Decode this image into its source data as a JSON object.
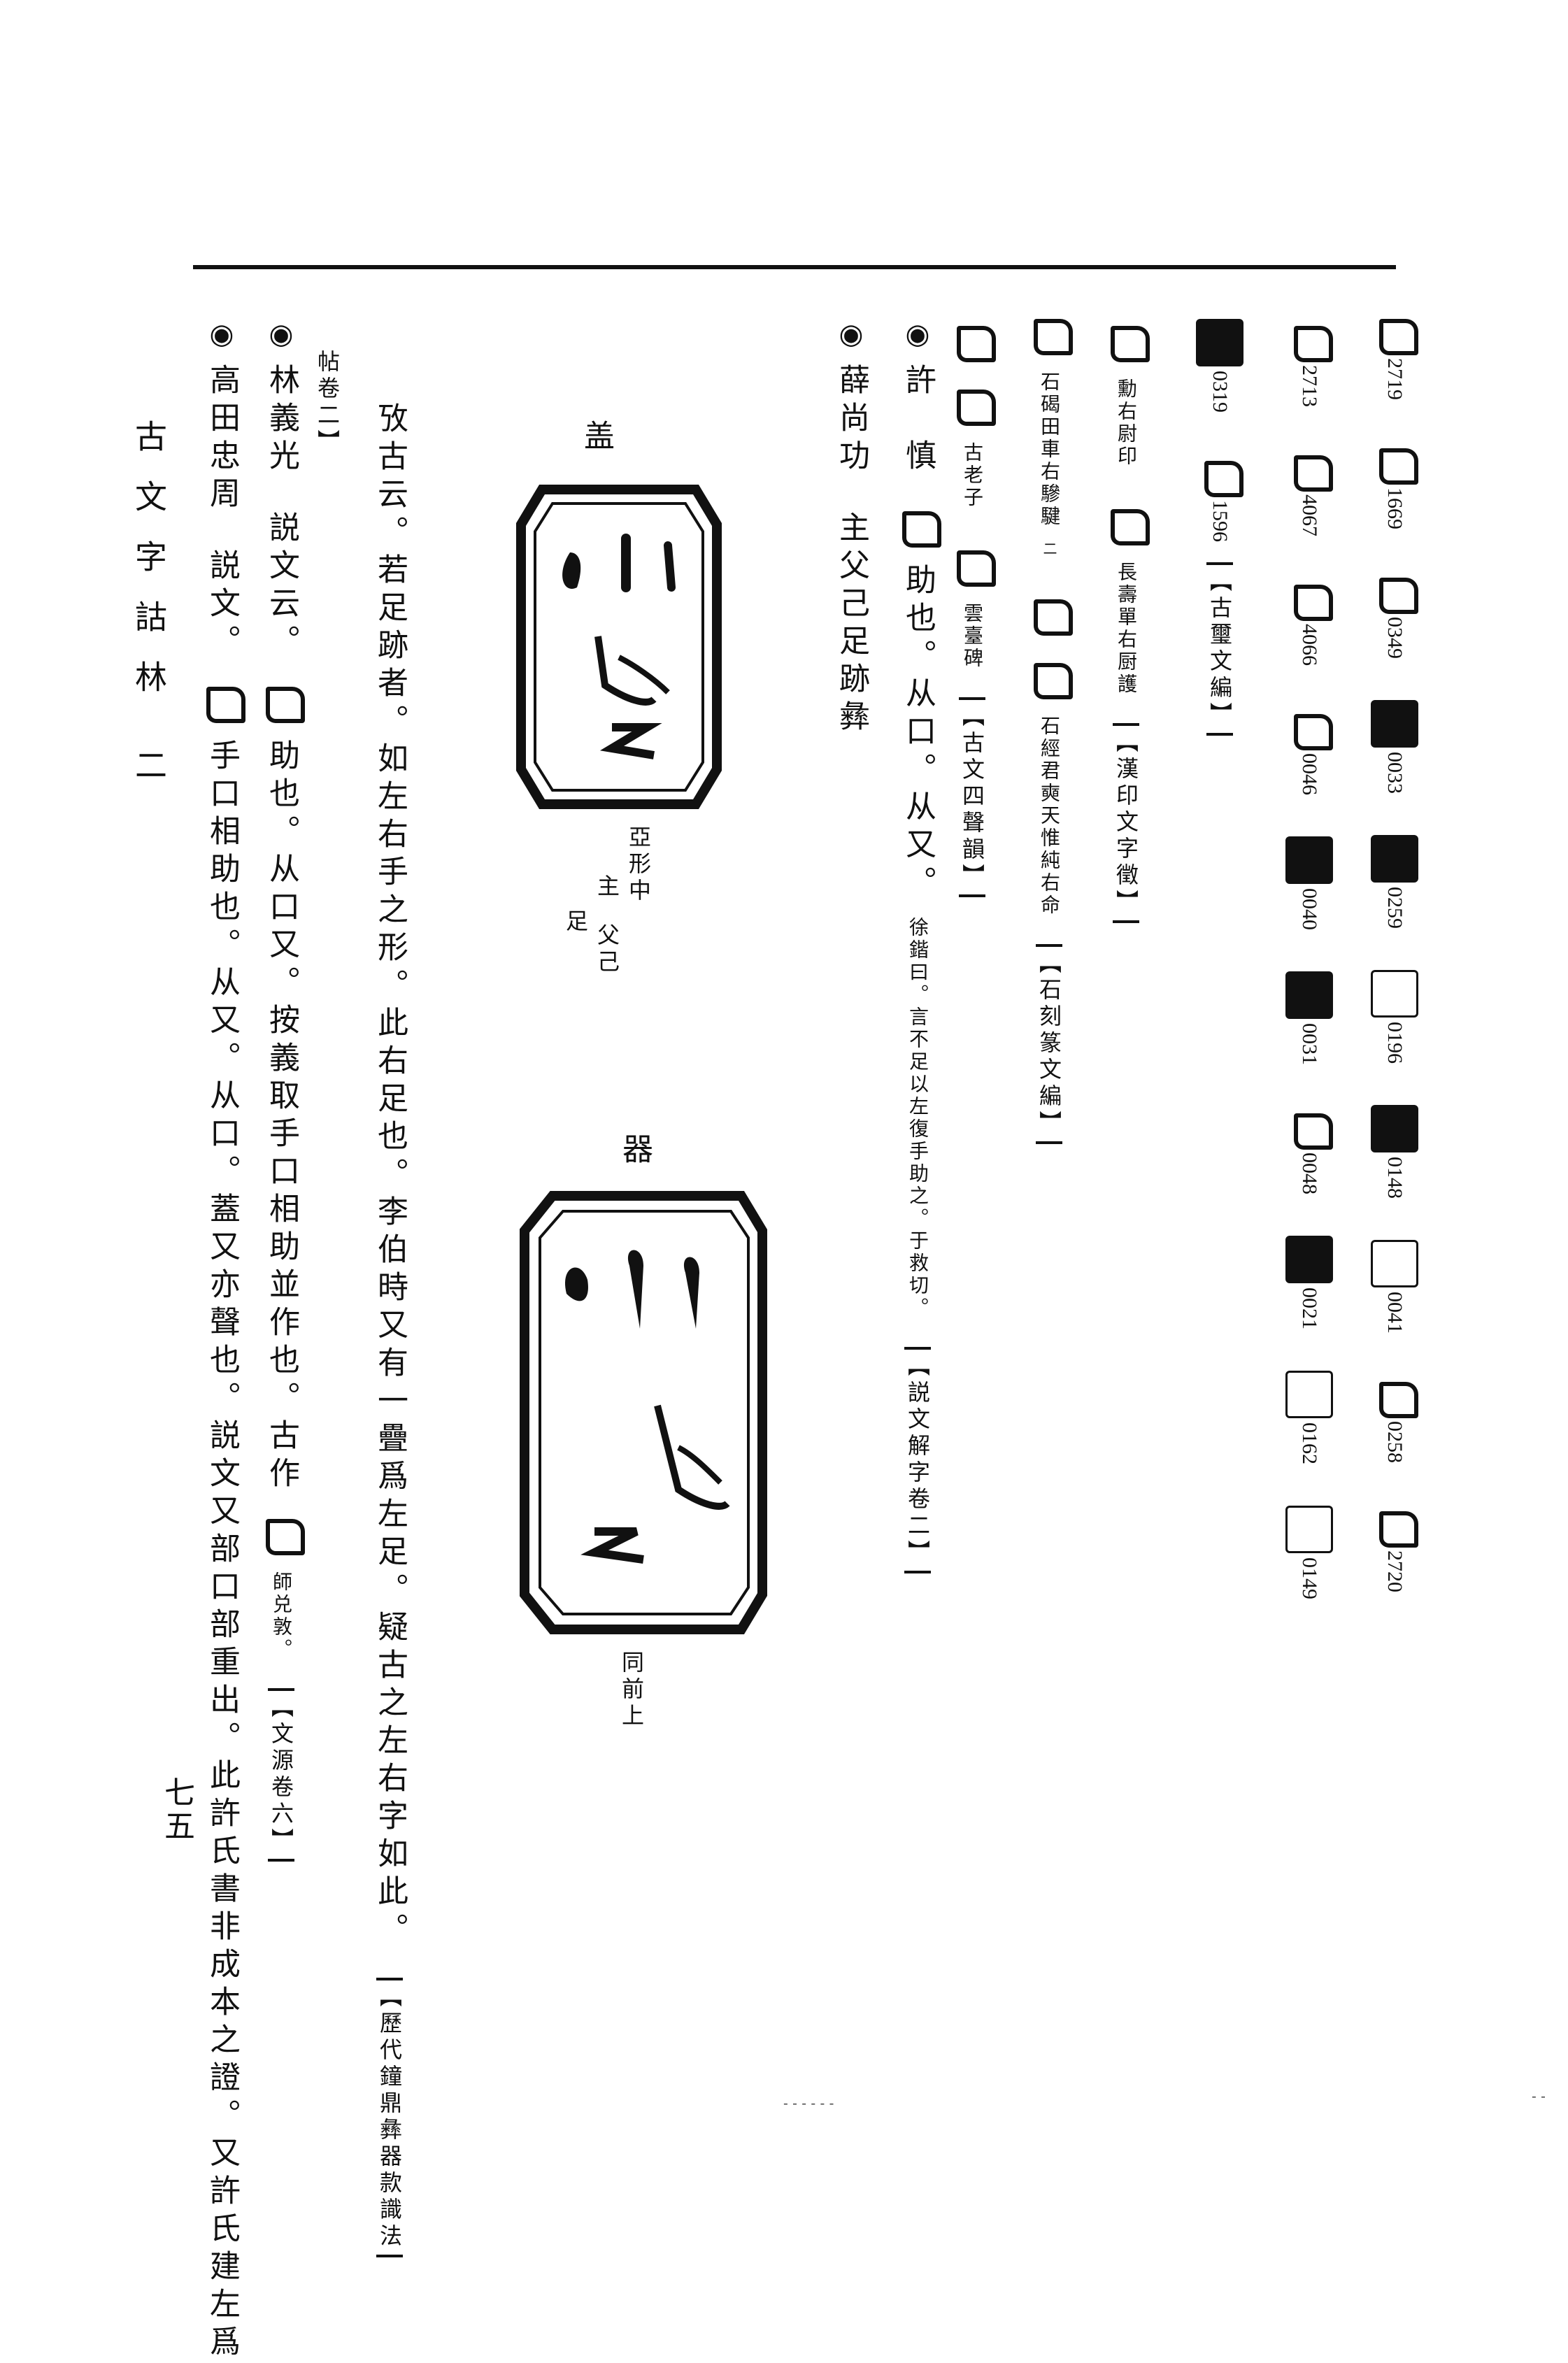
{
  "book": {
    "title": "古文字詁林",
    "volume": "二",
    "page": "七五"
  },
  "col1": {
    "items": [
      {
        "num": "2719"
      },
      {
        "num": "1669"
      },
      {
        "num": "0349"
      },
      {
        "num": "0033"
      },
      {
        "num": "0259"
      },
      {
        "num": "0196"
      },
      {
        "num": "0148"
      },
      {
        "num": "0041"
      },
      {
        "num": "0258"
      },
      {
        "num": "2720"
      }
    ]
  },
  "col2": {
    "items": [
      {
        "num": "2713"
      },
      {
        "num": "4067"
      },
      {
        "num": "4066"
      },
      {
        "num": "0046"
      },
      {
        "num": "0040"
      },
      {
        "num": "0031"
      },
      {
        "num": "0048"
      },
      {
        "num": "0021"
      },
      {
        "num": "0162"
      },
      {
        "num": "0149"
      }
    ]
  },
  "col3": {
    "n1": "0319",
    "n2": "1596",
    "source": "【古璽文編】"
  },
  "col4": {
    "caption1": "勳右尉印",
    "caption2": "長壽單右厨護",
    "source": "【漢印文字徵】"
  },
  "col5": {
    "caption1": "石碣田車右驂騝",
    "note": "二",
    "caption2": "石經君奭天惟純右命",
    "source": "【石刻篆文編】"
  },
  "col6": {
    "caption1": "古老子",
    "caption2": "雲臺碑",
    "source": "【古文四聲韻】"
  },
  "col7": {
    "bullet": "◉",
    "name": "許　慎",
    "text": "助也。从口。从又。",
    "note": "徐鍇曰。言不足以左復手助之。于救切。",
    "source": "【説文解字卷二】"
  },
  "col8": {
    "bullet": "◉",
    "name": "薛尚功",
    "text": "主父己足跡彝"
  },
  "insc": {
    "label_top": "盖",
    "label_mid1": "亞形中",
    "label_mid2": "主",
    "label_mid3": "足",
    "label_mid4": "父己",
    "label_qi": "器",
    "label_bottom": "同前上"
  },
  "col9": {
    "text": "攷古云。若足跡者。如左右手之形。此右足也。李伯時又有一疊爲左足。疑古之左右字如此。",
    "source": "【歷代鐘鼎彝器款識法"
  },
  "col10": {
    "text": "帖卷二】"
  },
  "col11": {
    "bullet": "◉",
    "name": "林義光",
    "text": "説文云。",
    "text2": "助也。从口又。按義取手口相助並作也。古作",
    "note": "師兑敦。",
    "source": "【文源卷六】"
  },
  "col12": {
    "bullet": "◉",
    "name": "高田忠周",
    "text": "説文。",
    "text2": "手口相助也。从又。从口。蓋又亦聲也。説文又部口部重出。此許氏書非成本之證。又許氏建左爲"
  }
}
